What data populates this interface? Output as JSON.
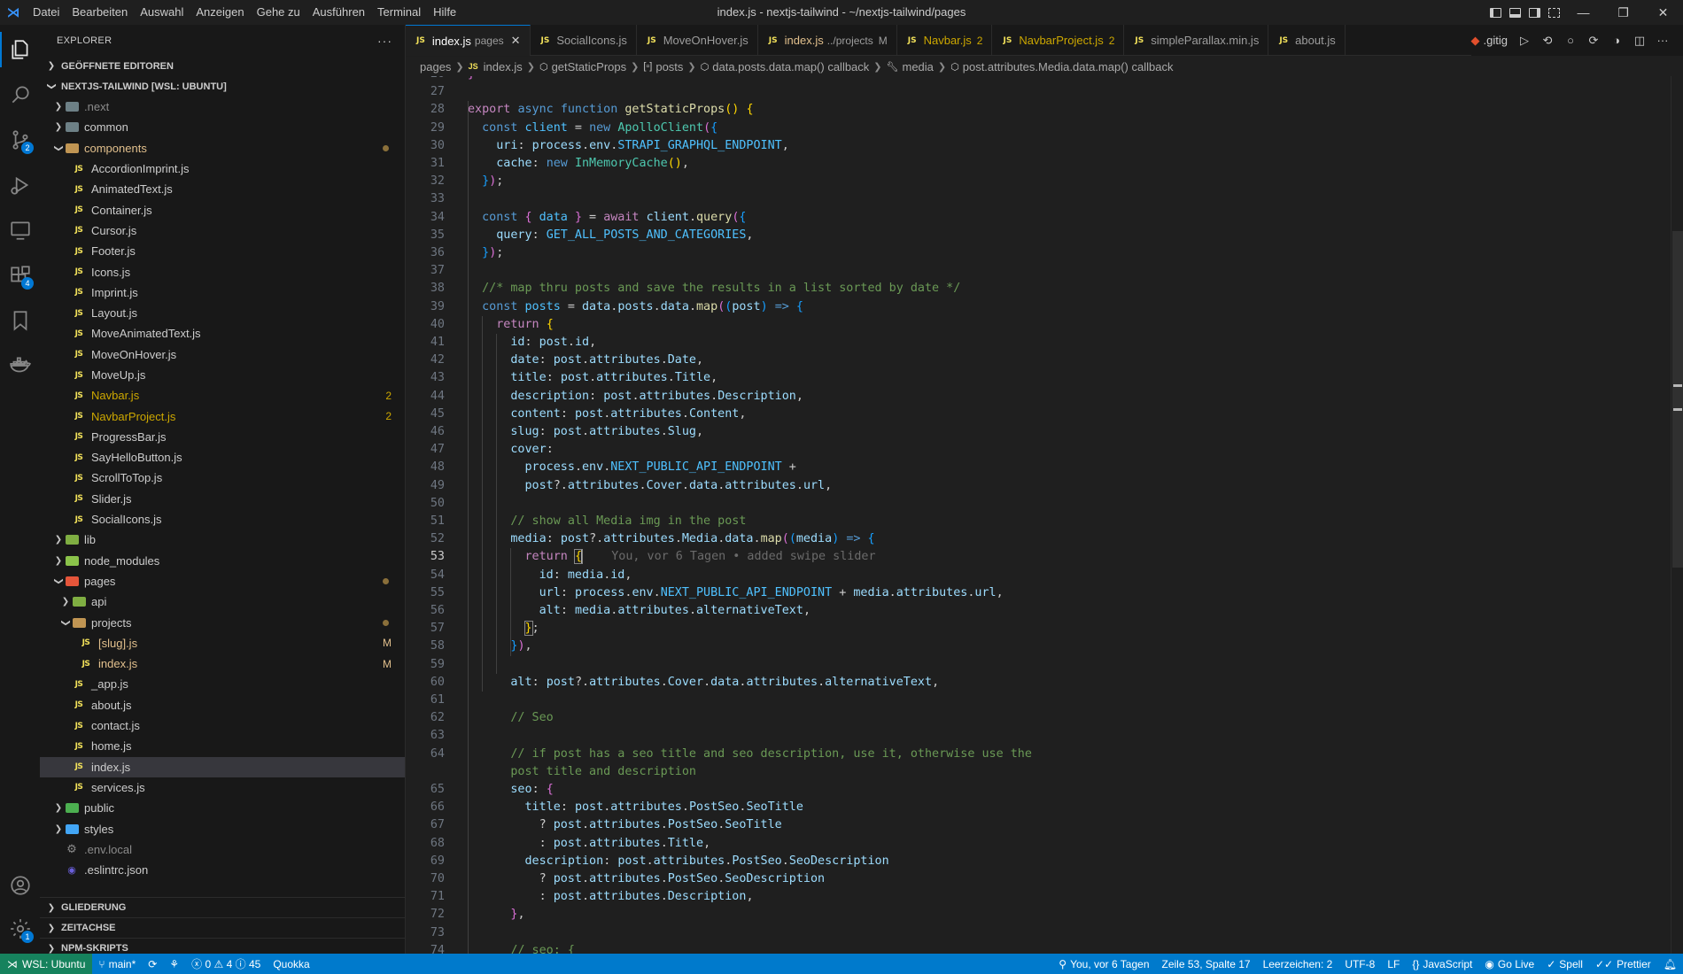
{
  "window": {
    "title": "index.js - nextjs-tailwind - ~/nextjs-tailwind/pages",
    "menu": [
      "Datei",
      "Bearbeiten",
      "Auswahl",
      "Anzeigen",
      "Gehe zu",
      "Ausführen",
      "Terminal",
      "Hilfe"
    ]
  },
  "activity": {
    "source_control_badge": "2",
    "extensions_badge": "4",
    "settings_badge": "1"
  },
  "sidebar": {
    "header": "EXPLORER",
    "more": "···",
    "open_editors": "GEÖFFNETE EDITOREN",
    "workspace": "NEXTJS-TAILWIND [WSL: UBUNTU]",
    "outline": "GLIEDERUNG",
    "timeline": "ZEITACHSE",
    "npm": "NPM-SKRIPTS",
    "tree": [
      {
        "label": ".next",
        "kind": "folder",
        "depth": 0,
        "open": false,
        "color": "#6d8086",
        "style": "dim"
      },
      {
        "label": "common",
        "kind": "folder",
        "depth": 0,
        "open": false,
        "color": "#6d8086"
      },
      {
        "label": "components",
        "kind": "folder",
        "depth": 0,
        "open": true,
        "color": "#c09553",
        "style": "mod",
        "dot": true
      },
      {
        "label": "AccordionImprint.js",
        "kind": "js",
        "depth": 1
      },
      {
        "label": "AnimatedText.js",
        "kind": "js",
        "depth": 1
      },
      {
        "label": "Container.js",
        "kind": "js",
        "depth": 1
      },
      {
        "label": "Cursor.js",
        "kind": "js",
        "depth": 1
      },
      {
        "label": "Footer.js",
        "kind": "js",
        "depth": 1
      },
      {
        "label": "Icons.js",
        "kind": "js",
        "depth": 1
      },
      {
        "label": "Imprint.js",
        "kind": "js",
        "depth": 1
      },
      {
        "label": "Layout.js",
        "kind": "js",
        "depth": 1
      },
      {
        "label": "MoveAnimatedText.js",
        "kind": "js",
        "depth": 1
      },
      {
        "label": "MoveOnHover.js",
        "kind": "js",
        "depth": 1
      },
      {
        "label": "MoveUp.js",
        "kind": "js",
        "depth": 1
      },
      {
        "label": "Navbar.js",
        "kind": "js",
        "depth": 1,
        "style": "warn",
        "dec": "2"
      },
      {
        "label": "NavbarProject.js",
        "kind": "js",
        "depth": 1,
        "style": "warn",
        "dec": "2"
      },
      {
        "label": "ProgressBar.js",
        "kind": "js",
        "depth": 1
      },
      {
        "label": "SayHelloButton.js",
        "kind": "js",
        "depth": 1
      },
      {
        "label": "ScrollToTop.js",
        "kind": "js",
        "depth": 1
      },
      {
        "label": "Slider.js",
        "kind": "js",
        "depth": 1
      },
      {
        "label": "SocialIcons.js",
        "kind": "js",
        "depth": 1
      },
      {
        "label": "lib",
        "kind": "folder",
        "depth": 0,
        "open": false,
        "color": "#7fae42"
      },
      {
        "label": "node_modules",
        "kind": "folder",
        "depth": 0,
        "open": false,
        "color": "#8bc34a"
      },
      {
        "label": "pages",
        "kind": "folder",
        "depth": 0,
        "open": true,
        "color": "#e5553a",
        "dot": true
      },
      {
        "label": "api",
        "kind": "folder",
        "depth": 1,
        "open": false,
        "color": "#7fae42"
      },
      {
        "label": "projects",
        "kind": "folder",
        "depth": 1,
        "open": true,
        "color": "#c09553",
        "dot": true
      },
      {
        "label": "[slug].js",
        "kind": "js",
        "depth": 2,
        "style": "mod",
        "dec": "M"
      },
      {
        "label": "index.js",
        "kind": "js",
        "depth": 2,
        "style": "mod",
        "dec": "M"
      },
      {
        "label": "_app.js",
        "kind": "js",
        "depth": 1
      },
      {
        "label": "about.js",
        "kind": "js",
        "depth": 1
      },
      {
        "label": "contact.js",
        "kind": "js",
        "depth": 1
      },
      {
        "label": "home.js",
        "kind": "js",
        "depth": 1
      },
      {
        "label": "index.js",
        "kind": "js",
        "depth": 1,
        "selected": true
      },
      {
        "label": "services.js",
        "kind": "js",
        "depth": 1
      },
      {
        "label": "public",
        "kind": "folder",
        "depth": 0,
        "open": false,
        "color": "#4caf50"
      },
      {
        "label": "styles",
        "kind": "folder",
        "depth": 0,
        "open": false,
        "color": "#42a5f5"
      },
      {
        "label": ".env.local",
        "kind": "gear",
        "depth": 0,
        "style": "dim"
      },
      {
        "label": ".eslintrc.json",
        "kind": "eslint",
        "depth": 0
      }
    ]
  },
  "tabs": [
    {
      "label": "index.js",
      "sub": "pages",
      "active": true,
      "close": "✕"
    },
    {
      "label": "SocialIcons.js"
    },
    {
      "label": "MoveOnHover.js"
    },
    {
      "label": "index.js",
      "sub": "../projects",
      "count": "M",
      "style": "mod"
    },
    {
      "label": "Navbar.js",
      "count": "2",
      "style": "warn"
    },
    {
      "label": "NavbarProject.js",
      "count": "2",
      "style": "warn"
    },
    {
      "label": "simpleParallax.min.js"
    },
    {
      "label": "about.js"
    }
  ],
  "tab_actions": {
    "git": ".gitig"
  },
  "breadcrumb": [
    "pages",
    "index.js",
    "getStaticProps",
    "posts",
    "data.posts.data.map() callback",
    "media",
    "post.attributes.Media.data.map() callback"
  ],
  "editor": {
    "current_line": 53,
    "blame": "You, vor 6 Tagen • added swipe slider"
  },
  "statusbar": {
    "remote": "WSL: Ubuntu",
    "branch": "main*",
    "errors": "0",
    "warnings": "4",
    "infos": "45",
    "quokka": "Quokka",
    "blame": "You, vor 6 Tagen",
    "position": "Zeile 53, Spalte 17",
    "indent": "Leerzeichen: 2",
    "encoding": "UTF-8",
    "eol": "LF",
    "language": "JavaScript",
    "golive": "Go Live",
    "spell": "Spell",
    "prettier": "Prettier"
  }
}
